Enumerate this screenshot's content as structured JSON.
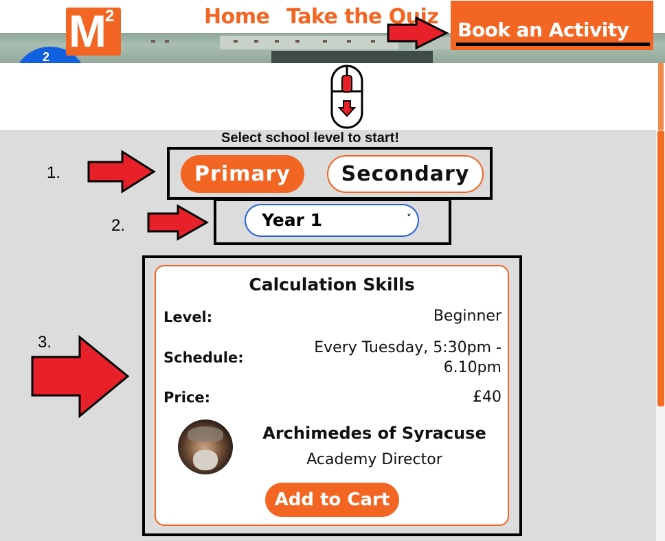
{
  "brand": {
    "logo_letter": "M",
    "logo_superscript": "2"
  },
  "nav": {
    "home": "Home",
    "quiz": "Take the Quiz",
    "book": "Book an Activity"
  },
  "hero": {
    "badge_text": "2"
  },
  "instructions": {
    "select_label": "Select school level to start!",
    "steps": [
      "1.",
      "2.",
      "3."
    ]
  },
  "level_buttons": {
    "primary": "Primary",
    "secondary": "Secondary",
    "selected": "Primary"
  },
  "year_select": {
    "value": "Year 1",
    "chevron": "˅"
  },
  "activity_card": {
    "title": "Calculation Skills",
    "level_label": "Level:",
    "level_value": "Beginner",
    "schedule_label": "Schedule:",
    "schedule_value": "Every Tuesday, 5:30pm - 6.10pm",
    "price_label": "Price:",
    "price_value": "£40",
    "tutor_name": "Archimedes of Syracuse",
    "tutor_role": "Academy Director",
    "add_to_cart": "Add to Cart"
  },
  "colors": {
    "accent": "#f26522",
    "annotation_arrow": "#e8202a",
    "content_bg": "#dcdcdc",
    "select_border": "#2b63d9"
  },
  "icons": [
    "mouse-scroll-icon",
    "arrow-right-icon"
  ]
}
